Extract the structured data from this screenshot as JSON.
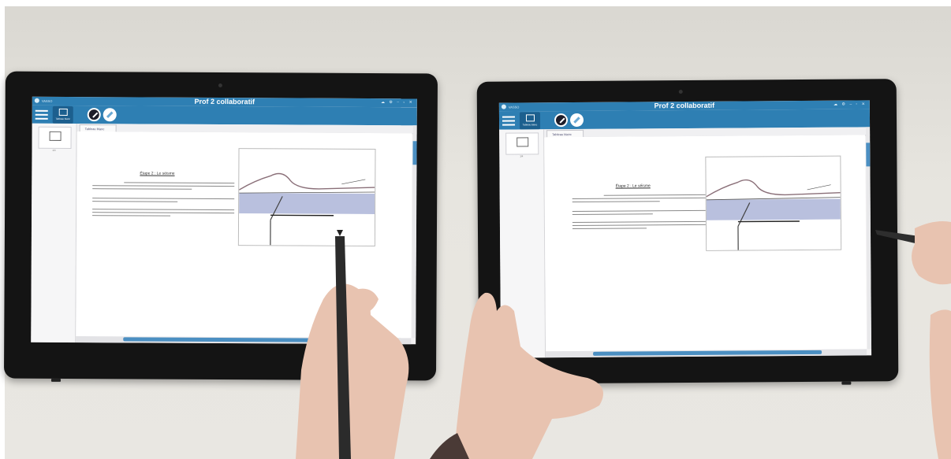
{
  "photo": {
    "description_tablets": 2
  },
  "left_tablet": {
    "window_title": "Prof 2 collaboratif",
    "app_name": "VASSO",
    "board_tab_label": "Tableau blanc",
    "content_tab": "Tableau blanc",
    "thumb_page": "1/4",
    "doc_heading": "Étape 2 : Le séisme"
  },
  "right_tablet": {
    "window_title": "Prof 2 collaboratif",
    "app_name": "VASSO",
    "board_tab_label": "Tableau blanc",
    "content_tab": "Tableau blanc",
    "thumb_page": "1/4",
    "doc_heading": "Étape 2 : Le séisme"
  },
  "colors": {
    "titlebar": "#2e7fb3",
    "scrollbar": "#4b8fc2",
    "water": "#b9c0de"
  },
  "icons": [
    "menu-icon",
    "whiteboard-icon",
    "pen-tool-icon",
    "eraser-tool-icon",
    "cloud-icon",
    "settings-icon"
  ]
}
